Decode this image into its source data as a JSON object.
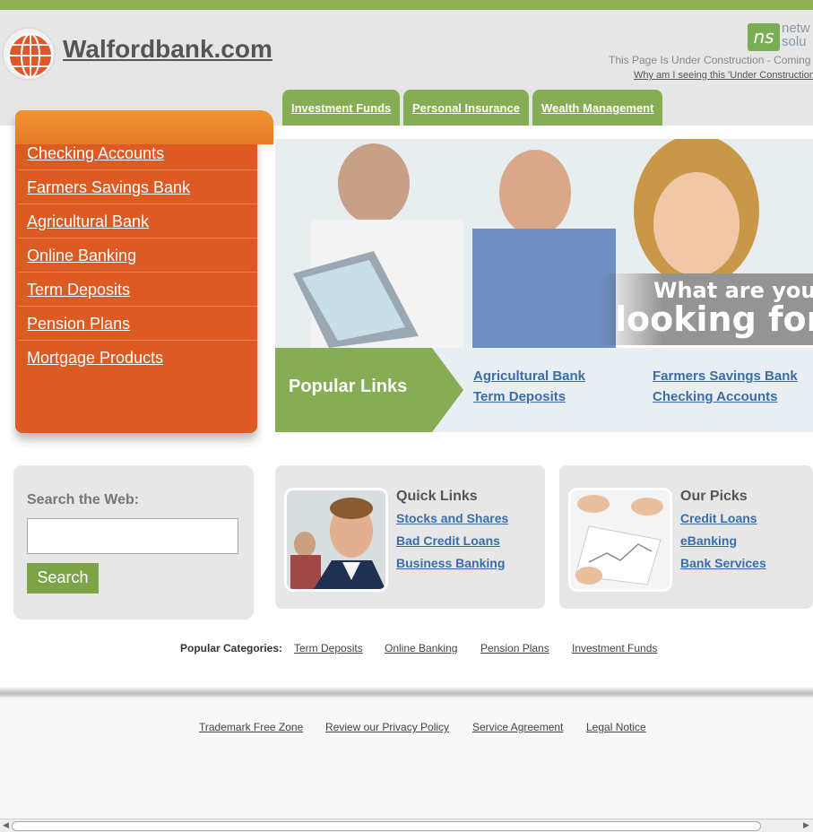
{
  "header": {
    "site_title": "Walfordbank.com",
    "ns_logo_text": "ns",
    "ns_brand_partial": [
      "netw",
      "solu"
    ],
    "under_construction": "This Page Is Under Construction - Coming",
    "why_link": "Why am I seeing this 'Under Construction"
  },
  "tabs": [
    "Investment Funds",
    "Personal Insurance",
    "Wealth Management"
  ],
  "sidebar": {
    "items": [
      "Checking Accounts",
      "Farmers Savings Bank",
      "Agricultural Bank",
      "Online Banking",
      "Term Deposits",
      "Pension Plans",
      "Mortgage Products"
    ]
  },
  "hero": {
    "line1": "What are you",
    "line2": "looking for?"
  },
  "popular": {
    "title": "Popular Links",
    "links": [
      "Agricultural Bank",
      "Term Deposits",
      "Farmers Savings Bank",
      "Checking Accounts"
    ]
  },
  "search": {
    "label": "Search the Web:",
    "placeholder": "",
    "button": "Search"
  },
  "quick_links": {
    "title": "Quick Links",
    "links": [
      "Stocks and Shares",
      "Bad Credit Loans",
      "Business Banking"
    ]
  },
  "our_picks": {
    "title": "Our Picks",
    "links": [
      "Credit Loans",
      "eBanking",
      "Bank Services"
    ]
  },
  "categories": {
    "label": "Popular Categories:",
    "links": [
      "Term Deposits",
      "Online Banking",
      "Pension Plans",
      "Investment Funds"
    ]
  },
  "footer": {
    "links": [
      "Trademark Free Zone",
      "Review our Privacy Policy",
      "Service Agreement",
      "Legal Notice"
    ]
  },
  "colors": {
    "green": "#86ad55",
    "orange": "#dd5a22",
    "link_blue": "#3a6da8"
  }
}
